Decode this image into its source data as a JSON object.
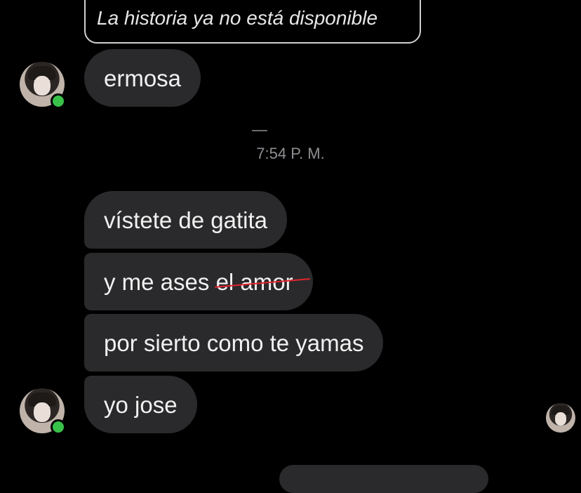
{
  "story_reply": {
    "text": "La historia ya no está disponible"
  },
  "messages": [
    {
      "text": "ermosa"
    },
    {
      "text": "vístete de gatita"
    },
    {
      "text_prefix": "y me ases ",
      "text_struck": "el amor"
    },
    {
      "text": "por sierto como te yamas"
    },
    {
      "text": "yo jose"
    }
  ],
  "timestamp": "7:54 P. M.",
  "colors": {
    "background": "#000000",
    "bubble": "#2a2a2c",
    "online_dot": "#39c24a",
    "strike_line": "#e0242c"
  },
  "icons": [
    "avatar",
    "online-status-icon",
    "read-receipt-avatar"
  ]
}
